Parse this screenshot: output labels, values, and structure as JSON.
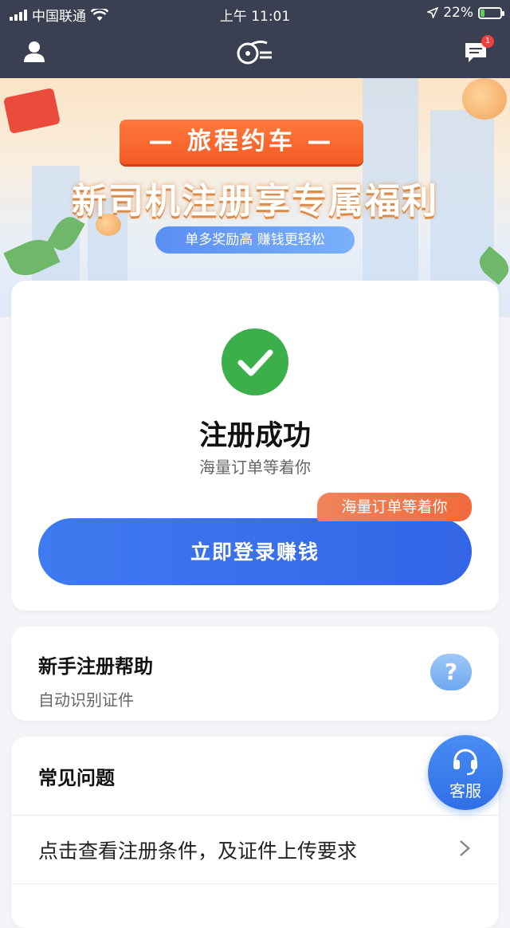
{
  "status_bar": {
    "carrier": "中国联通",
    "time": "上午 11:01",
    "battery": "22%",
    "battery_level": 0.22
  },
  "nav": {
    "message_badge": "1"
  },
  "banner": {
    "ribbon": "— 旅程约车 —",
    "headline": "新司机注册享专属福利",
    "pill": "单多奖励高 赚钱更轻松"
  },
  "success": {
    "title": "注册成功",
    "subtitle": "海量订单等着你",
    "tag": "海量订单等着你",
    "button": "立即登录赚钱"
  },
  "help": {
    "title": "新手注册帮助",
    "subtitle": "自动识别证件",
    "bubble": "?"
  },
  "faq": {
    "title": "常见问题",
    "item": "点击查看注册条件，及证件上传要求"
  },
  "customer_service": {
    "label": "客服"
  },
  "colors": {
    "primary": "#3365e6",
    "success": "#3bb04a",
    "accent": "#f26a3e",
    "topbar": "#3a3f52"
  }
}
